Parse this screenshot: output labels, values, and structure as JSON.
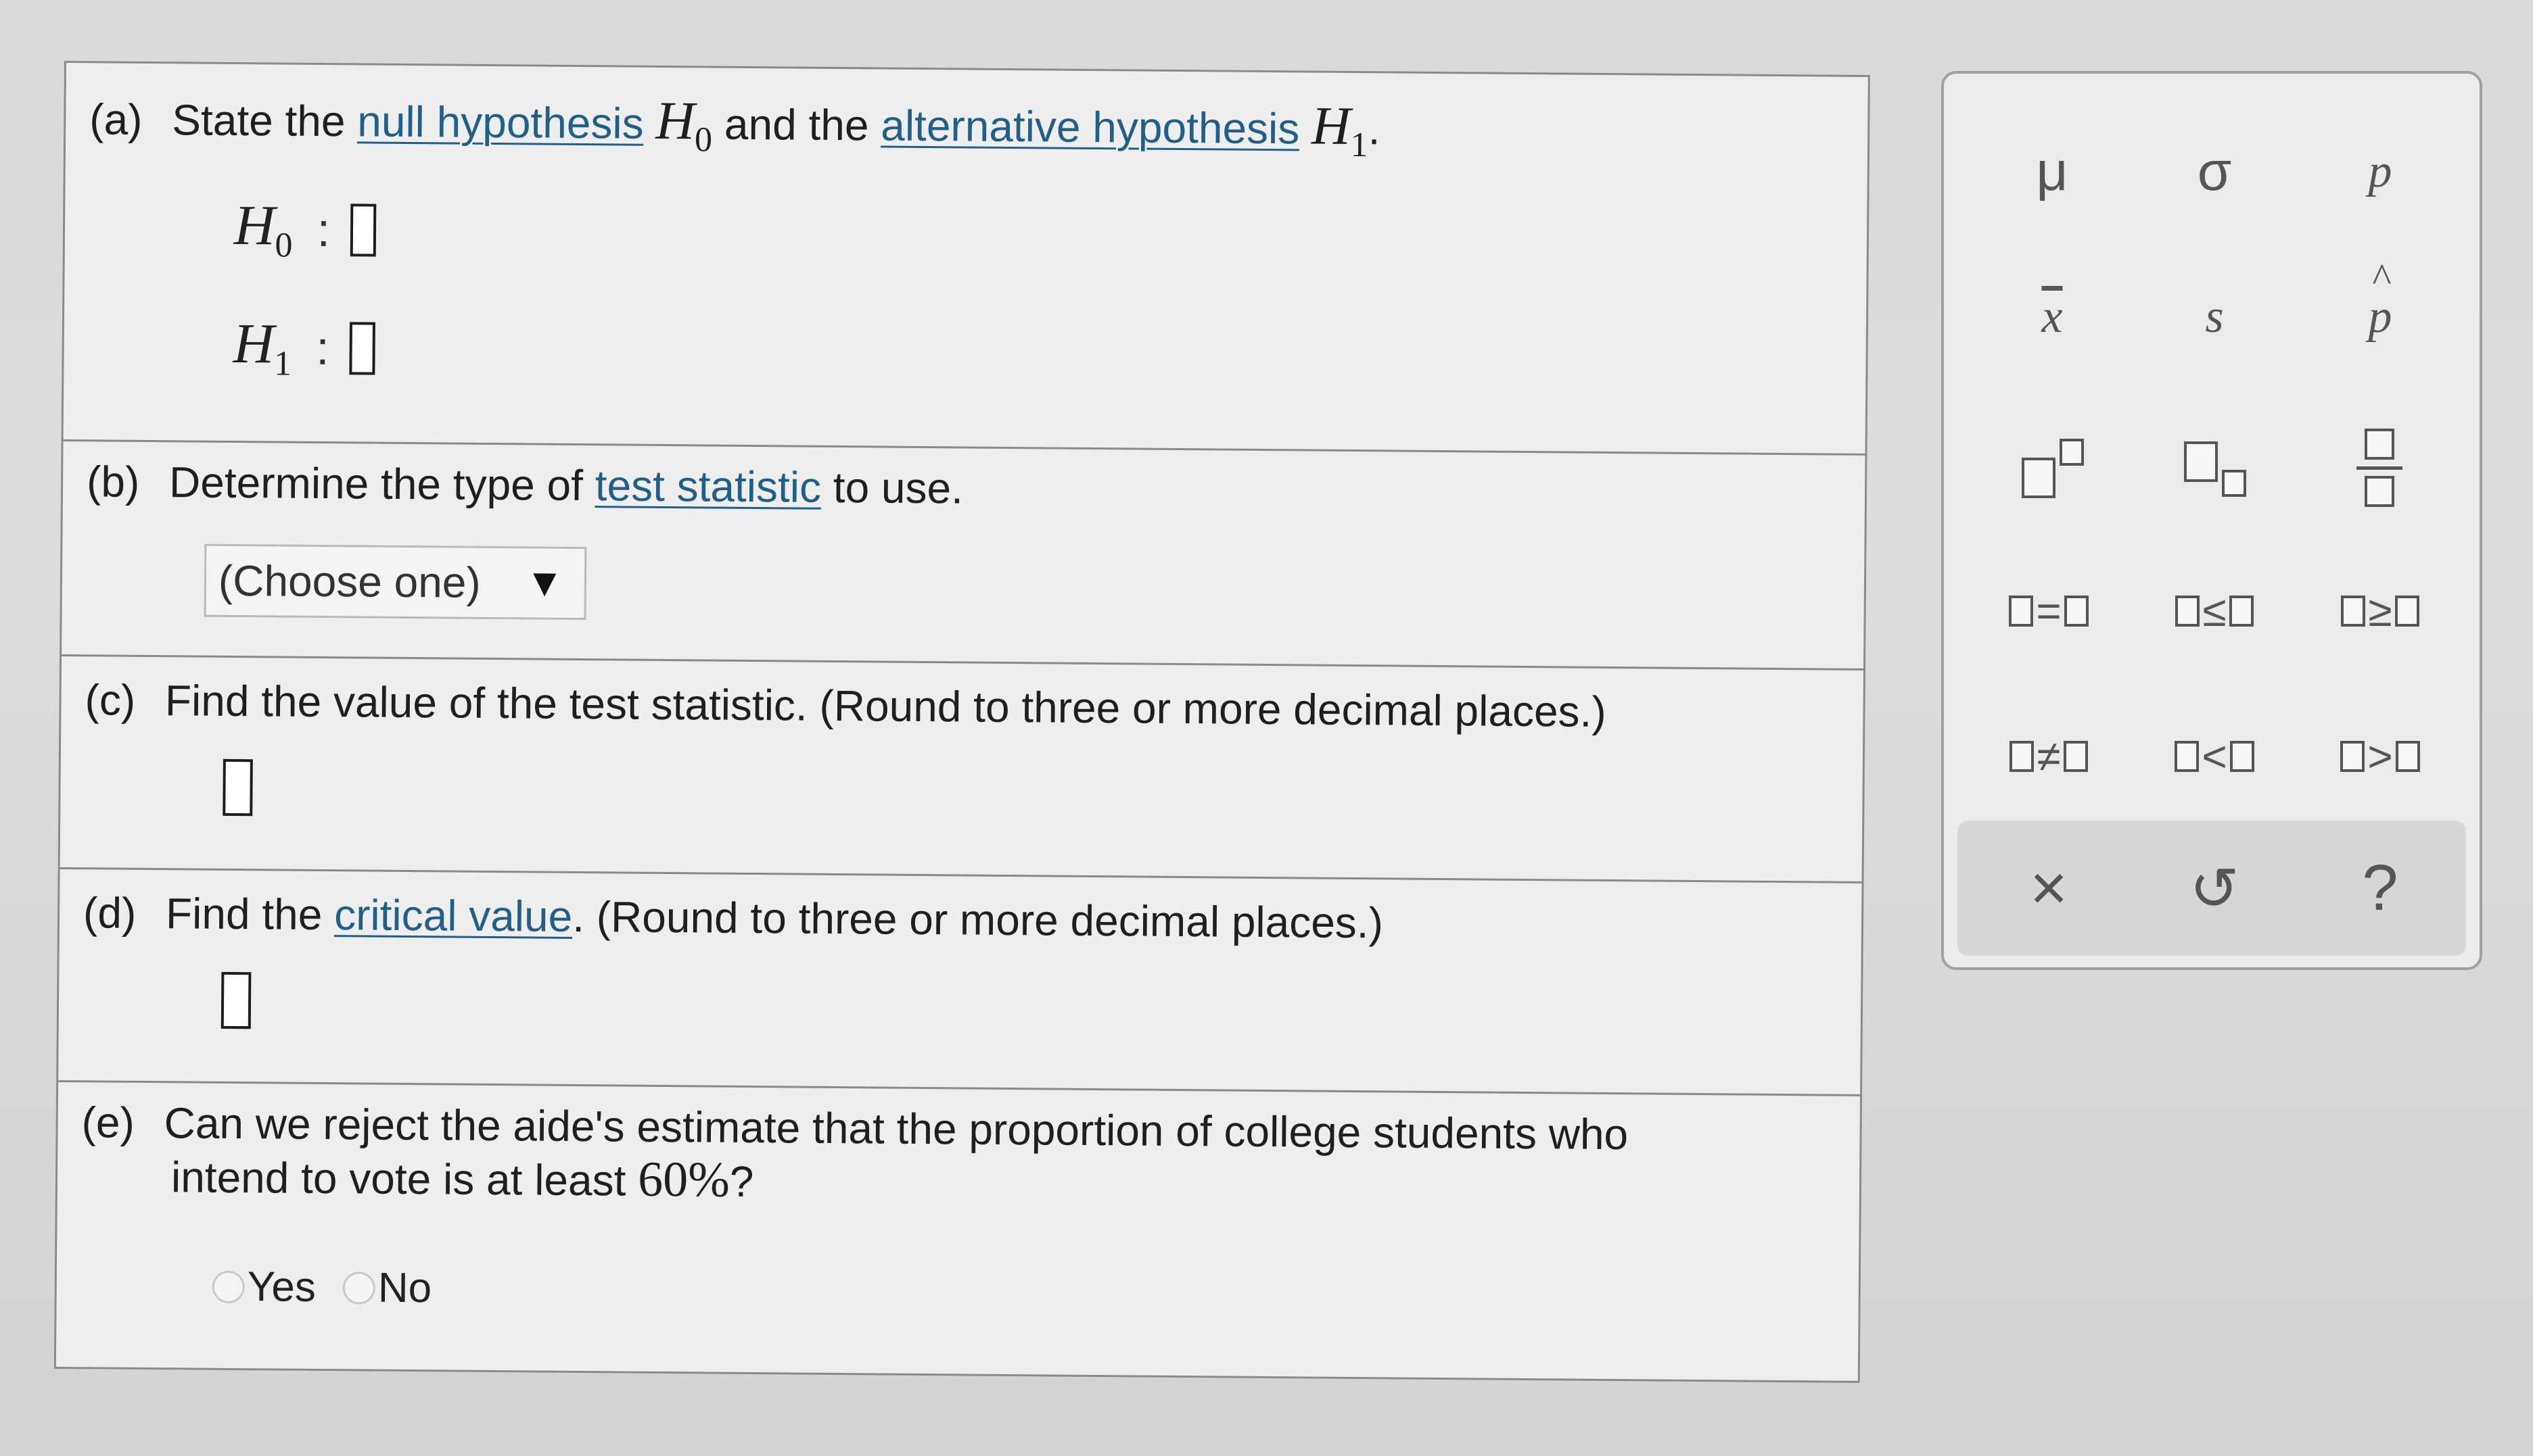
{
  "part_a": {
    "label": "(a)",
    "text_1": "State the",
    "link_null": "null hypothesis",
    "null_symbol": "H",
    "null_sub": "0",
    "text_2": "and the",
    "link_alt": "alternative hypothesis",
    "alt_symbol": "H",
    "alt_sub": "1",
    "text_end": ".",
    "h0_symbol": "H",
    "h0_sub": "0",
    "h1_symbol": "H",
    "h1_sub": "1",
    "colon": ":"
  },
  "part_b": {
    "label": "(b)",
    "text_1": "Determine the type of",
    "link": "test statistic",
    "text_2": "to use.",
    "select_value": "(Choose one)",
    "select_arrow": "▼"
  },
  "part_c": {
    "label": "(c)",
    "text": "Find the value of the test statistic. (Round to three or more decimal places.)"
  },
  "part_d": {
    "label": "(d)",
    "text_1": "Find the",
    "link": "critical value",
    "text_2": ". (Round to three or more decimal places.)"
  },
  "part_e": {
    "label": "(e)",
    "line_1": "Can we reject the aide's estimate that the proportion of college students who",
    "line_2_prefix": "intend to vote is at least",
    "line_2_value": "60%",
    "line_2_suffix": "?",
    "options": [
      "Yes",
      "No"
    ]
  },
  "palette": {
    "row1": [
      "μ",
      "σ",
      "p"
    ],
    "row2": [
      "x",
      "s",
      "p"
    ],
    "relations_row1": [
      "=",
      "≤",
      "≥"
    ],
    "relations_row2": [
      "≠",
      "<",
      ">"
    ],
    "footer": [
      "×",
      "↺",
      "?"
    ]
  },
  "colors": {
    "link": "#1f5f8a",
    "panel_bg": "#eeeeee",
    "border": "#8a8a8a"
  }
}
